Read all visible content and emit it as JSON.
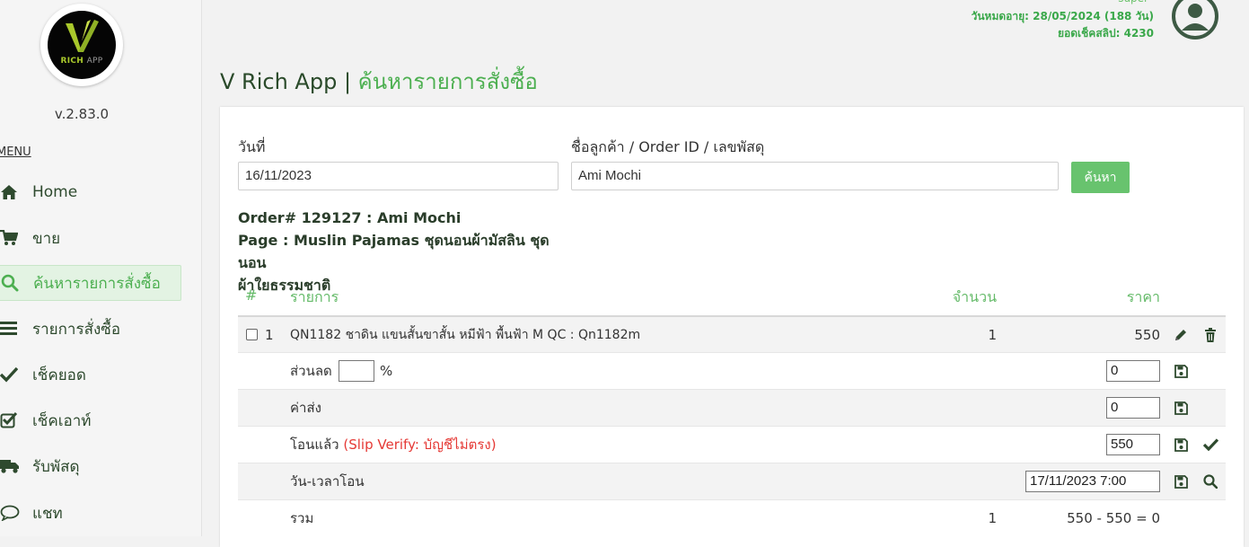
{
  "app": {
    "logo_text": "RICH",
    "logo_text2": "APP",
    "version": "v.2.83.0"
  },
  "menu": {
    "title": "MENU",
    "items": [
      {
        "label": "Home",
        "icon": "home-icon"
      },
      {
        "label": "ขาย",
        "icon": "cart-icon"
      },
      {
        "label": "ค้นหารายการสั่งซื้อ",
        "icon": "search-icon",
        "active": true
      },
      {
        "label": "รายการสั่งซื้อ",
        "icon": "list-icon"
      },
      {
        "label": "เช็คยอด",
        "icon": "check-icon"
      },
      {
        "label": "เช็คเอาท์",
        "icon": "checkbox-icon"
      },
      {
        "label": "รับพัสดุ",
        "icon": "truck-icon"
      },
      {
        "label": "แชท",
        "icon": "chat-icon"
      }
    ]
  },
  "header": {
    "role": "super",
    "expiry": "วันหมดอายุ: 28/05/2024 (188 วัน)",
    "slip_balance": "ยอดเช็คสลิป: 4230",
    "title_prefix": "V Rich App | ",
    "title_highlight": "ค้นหารายการสั่งซื้อ"
  },
  "search": {
    "date_label": "วันที่",
    "date_value": "16/11/2023",
    "query_label": "ชื่อลูกค้า / Order ID / เลขพัสดุ",
    "query_value": "Ami Mochi",
    "button_label": "ค้นหา"
  },
  "order": {
    "line1": "Order# 129127 : Ami Mochi",
    "line2": "Page : Muslin Pajamas ชุดนอนผ้ามัสลิน ชุดนอน",
    "line3": "ผ้าใยธรรมชาติ"
  },
  "table": {
    "headers": {
      "num": "#",
      "item": "รายการ",
      "qty": "จำนวน",
      "price": "ราคา"
    },
    "item": {
      "num": "1",
      "name": "QN1182 ชาดิน แขนสั้นขาสั้น หมีฟ้า พื้นฟ้า M QC : Qn1182m",
      "qty": "1",
      "price": "550"
    },
    "discount": {
      "label": "ส่วนลด",
      "percent_value": "",
      "percent_sign": "%",
      "value": "0"
    },
    "shipping": {
      "label": "ค่าส่ง",
      "value": "0"
    },
    "transferred": {
      "label": "โอนแล้ว",
      "warning": "(Slip Verify: บัญชีไม่ตรง)",
      "value": "550"
    },
    "transfer_time": {
      "label": "วัน-เวลาโอน",
      "value": "17/11/2023 7:00"
    },
    "total": {
      "label": "รวม",
      "qty": "1",
      "value": "550 - 550 = 0"
    }
  },
  "colors": {
    "accent": "#4caf50",
    "button": "#68c36e",
    "warning": "#e53935"
  }
}
